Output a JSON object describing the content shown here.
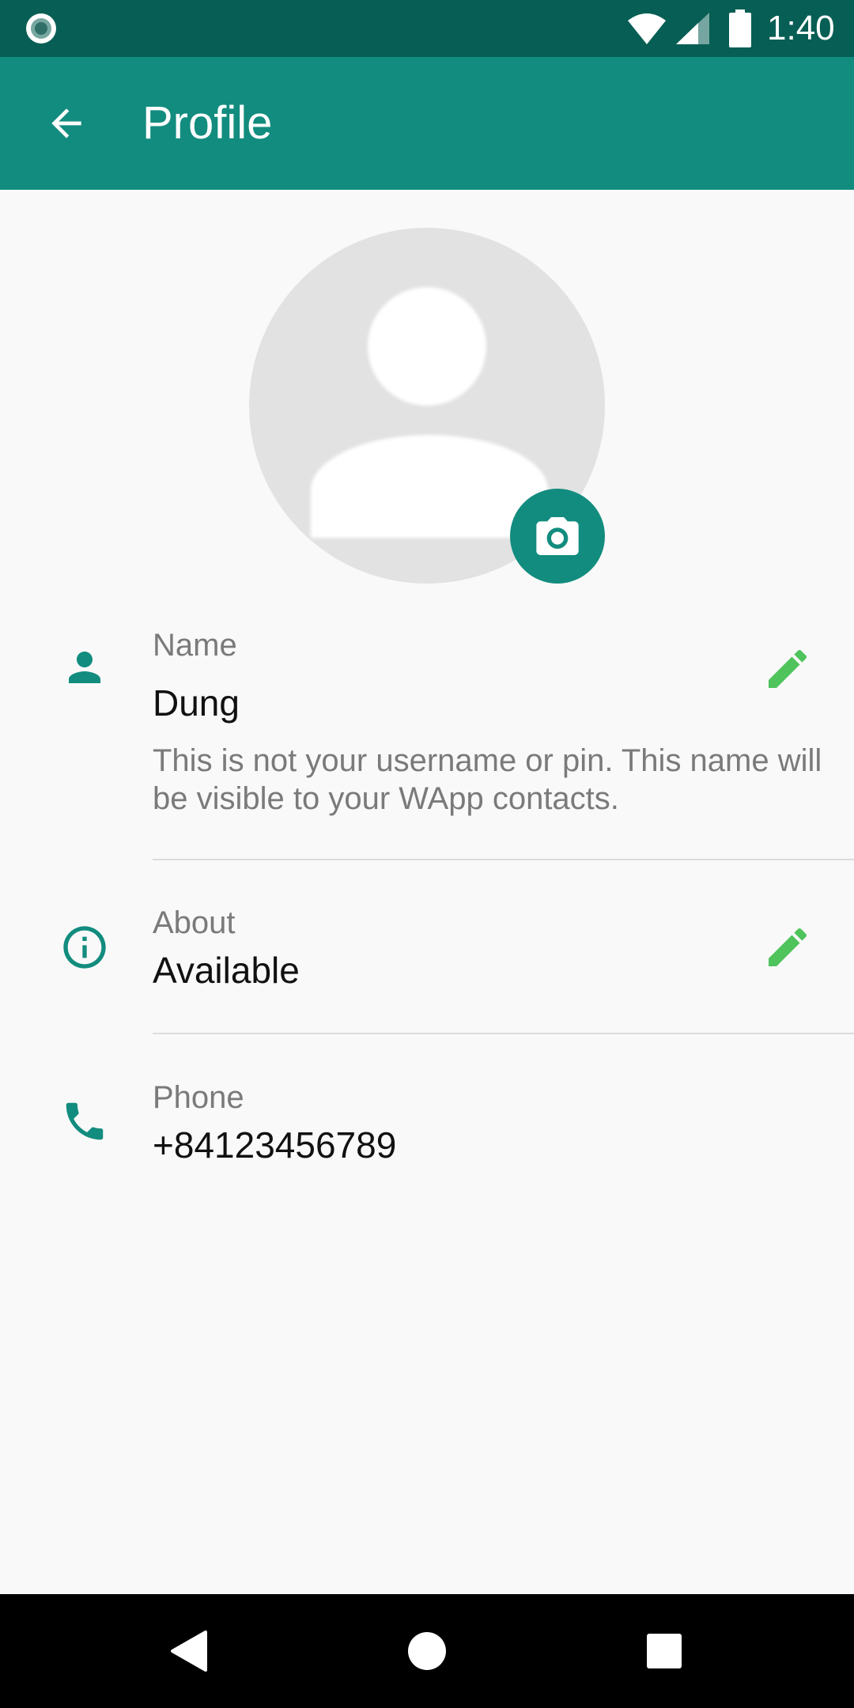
{
  "status_bar": {
    "time": "1:40",
    "icons": [
      "notification-icon",
      "wifi-icon",
      "signal-icon",
      "battery-icon"
    ]
  },
  "app_bar": {
    "title": "Profile",
    "back_icon": "arrow-back-icon"
  },
  "profile": {
    "avatar": "default-avatar",
    "camera_icon": "camera-icon",
    "name": {
      "label": "Name",
      "value": "Dung",
      "hint": "This is not your username or pin. This name will be visible to your WApp contacts.",
      "icon": "person-icon"
    },
    "about": {
      "label": "About",
      "value": "Available",
      "icon": "info-icon"
    },
    "phone": {
      "label": "Phone",
      "value": "+84123456789",
      "icon": "phone-icon"
    }
  },
  "colors": {
    "status_bar": "#075e54",
    "app_bar": "#128c7e",
    "accent_icon": "#128c7e",
    "edit_icon": "#4fc35c",
    "background": "#f9f9f9"
  },
  "nav_bar": {
    "icons": [
      "back-triangle-icon",
      "home-circle-icon",
      "recents-square-icon"
    ]
  }
}
